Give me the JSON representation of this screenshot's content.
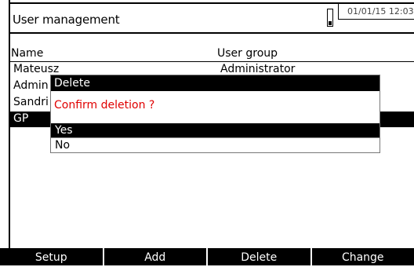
{
  "header": {
    "title": "User management",
    "datetime": "01/01/15 12:03",
    "battery_level": 0.25
  },
  "table": {
    "columns": [
      "Name",
      "User group"
    ],
    "rows": [
      {
        "name": "Mateusz",
        "group": "Administrator"
      },
      {
        "name": "Admin",
        "group": ""
      },
      {
        "name": "Sandri",
        "group": ""
      },
      {
        "name": "GP",
        "group": ""
      }
    ],
    "selected_index": 3
  },
  "dialog": {
    "title": "Delete",
    "message": "Confirm deletion ?",
    "options": [
      "Yes",
      "No"
    ],
    "selected_option": 0,
    "message_color": "#e00000"
  },
  "softkeys": [
    "Setup",
    "Add",
    "Delete",
    "Change"
  ]
}
